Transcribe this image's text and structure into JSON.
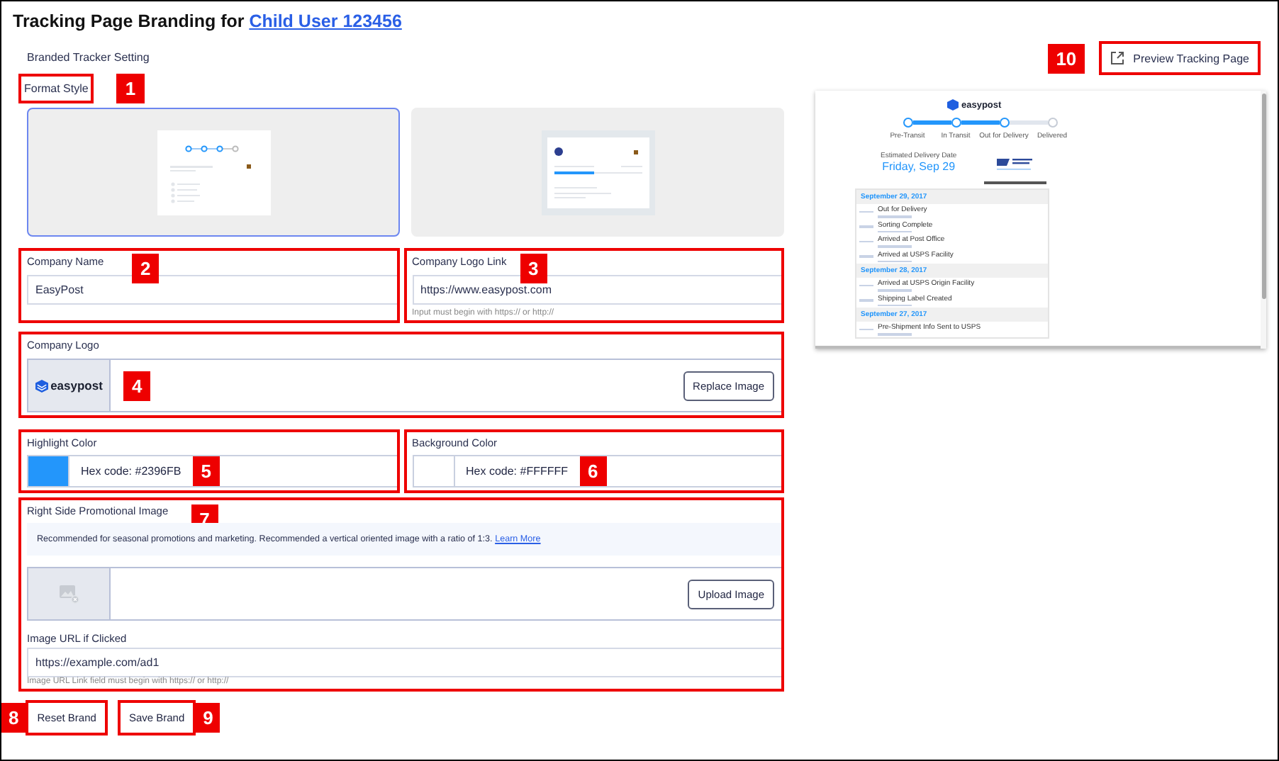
{
  "header": {
    "title": "Tracking Page Branding for",
    "user_link": "Child User 123456"
  },
  "section_title": "Branded Tracker Setting",
  "format_style": {
    "label": "Format Style",
    "callout": "1",
    "options": [
      {
        "selected": true
      },
      {
        "selected": false
      }
    ]
  },
  "company_name": {
    "label": "Company Name",
    "value": "EasyPost",
    "callout": "2"
  },
  "company_logo_link": {
    "label": "Company Logo Link",
    "value": "https://www.easypost.com",
    "hint": "Input must begin with https:// or http://",
    "callout": "3"
  },
  "company_logo": {
    "label": "Company Logo",
    "logo_text": "easypost",
    "button": "Replace Image",
    "callout": "4"
  },
  "highlight_color": {
    "label": "Highlight Color",
    "color": "#2396fb",
    "value": "Hex code: #2396FB",
    "callout": "5"
  },
  "background_color": {
    "label": "Background Color",
    "color": "#ffffff",
    "value": "Hex code: #FFFFFF",
    "callout": "6"
  },
  "promo": {
    "label": "Right Side Promotional Image",
    "notice": "Recommended for seasonal promotions and marketing. Recommended a vertical oriented image with a ratio of 1:3.",
    "notice_link": "Learn More",
    "button": "Upload Image",
    "url_label": "Image URL if Clicked",
    "url_value": "https://example.com/ad1",
    "url_hint": "Image URL Link field must begin with https:// or http://",
    "callout": "7"
  },
  "actions": [
    {
      "label": "Reset Brand",
      "callout": "8"
    },
    {
      "label": "Save Brand",
      "callout": "9"
    }
  ],
  "preview": {
    "button": "Preview Tracking Page",
    "callout": "10",
    "logo_text": "easypost",
    "steps": [
      {
        "label": "Pre-Transit",
        "done": true
      },
      {
        "label": "In Transit",
        "done": true
      },
      {
        "label": "Out for Delivery",
        "done": true
      },
      {
        "label": "Delivered",
        "done": false
      }
    ],
    "eta_label": "Estimated Delivery Date",
    "eta": "Friday, Sep 29",
    "days": [
      {
        "date": "September 29, 2017",
        "events": [
          {
            "title": "Out for Delivery"
          },
          {
            "title": "Sorting Complete"
          },
          {
            "title": "Arrived at Post Office"
          },
          {
            "title": "Arrived at USPS Facility"
          }
        ]
      },
      {
        "date": "September 28, 2017",
        "events": [
          {
            "title": "Arrived at USPS Origin Facility"
          },
          {
            "title": "Shipping Label Created"
          }
        ]
      },
      {
        "date": "September 27, 2017",
        "events": [
          {
            "title": "Pre-Shipment Info Sent to USPS"
          }
        ]
      }
    ]
  }
}
